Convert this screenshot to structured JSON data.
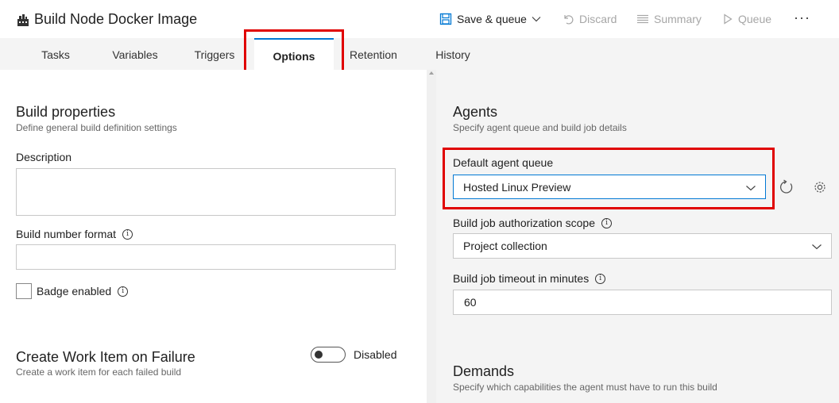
{
  "header": {
    "title": "Build Node Docker Image",
    "save_queue": "Save & queue",
    "discard": "Discard",
    "summary": "Summary",
    "queue": "Queue",
    "more": "···"
  },
  "tabs": [
    {
      "label": "Tasks"
    },
    {
      "label": "Variables"
    },
    {
      "label": "Triggers"
    },
    {
      "label": "Options",
      "active": true
    },
    {
      "label": "Retention"
    },
    {
      "label": "History"
    }
  ],
  "build_properties": {
    "title": "Build properties",
    "subtitle": "Define general build definition settings",
    "description_label": "Description",
    "description_value": "",
    "number_format_label": "Build number format",
    "number_format_value": "",
    "badge_label": "Badge enabled",
    "badge_checked": false
  },
  "work_item": {
    "title": "Create Work Item on Failure",
    "subtitle": "Create a work item for each failed build",
    "toggle_label": "Disabled",
    "enabled": false
  },
  "agents": {
    "title": "Agents",
    "subtitle": "Specify agent queue and build job details",
    "queue_label": "Default agent queue",
    "queue_value": "Hosted Linux Preview",
    "scope_label": "Build job authorization scope",
    "scope_value": "Project collection",
    "timeout_label": "Build job timeout in minutes",
    "timeout_value": "60"
  },
  "demands": {
    "title": "Demands",
    "subtitle": "Specify which capabilities the agent must have to run this build"
  },
  "colors": {
    "highlight": "#e00000",
    "accent": "#0078d4",
    "disabled_text": "#a6a6a6"
  }
}
